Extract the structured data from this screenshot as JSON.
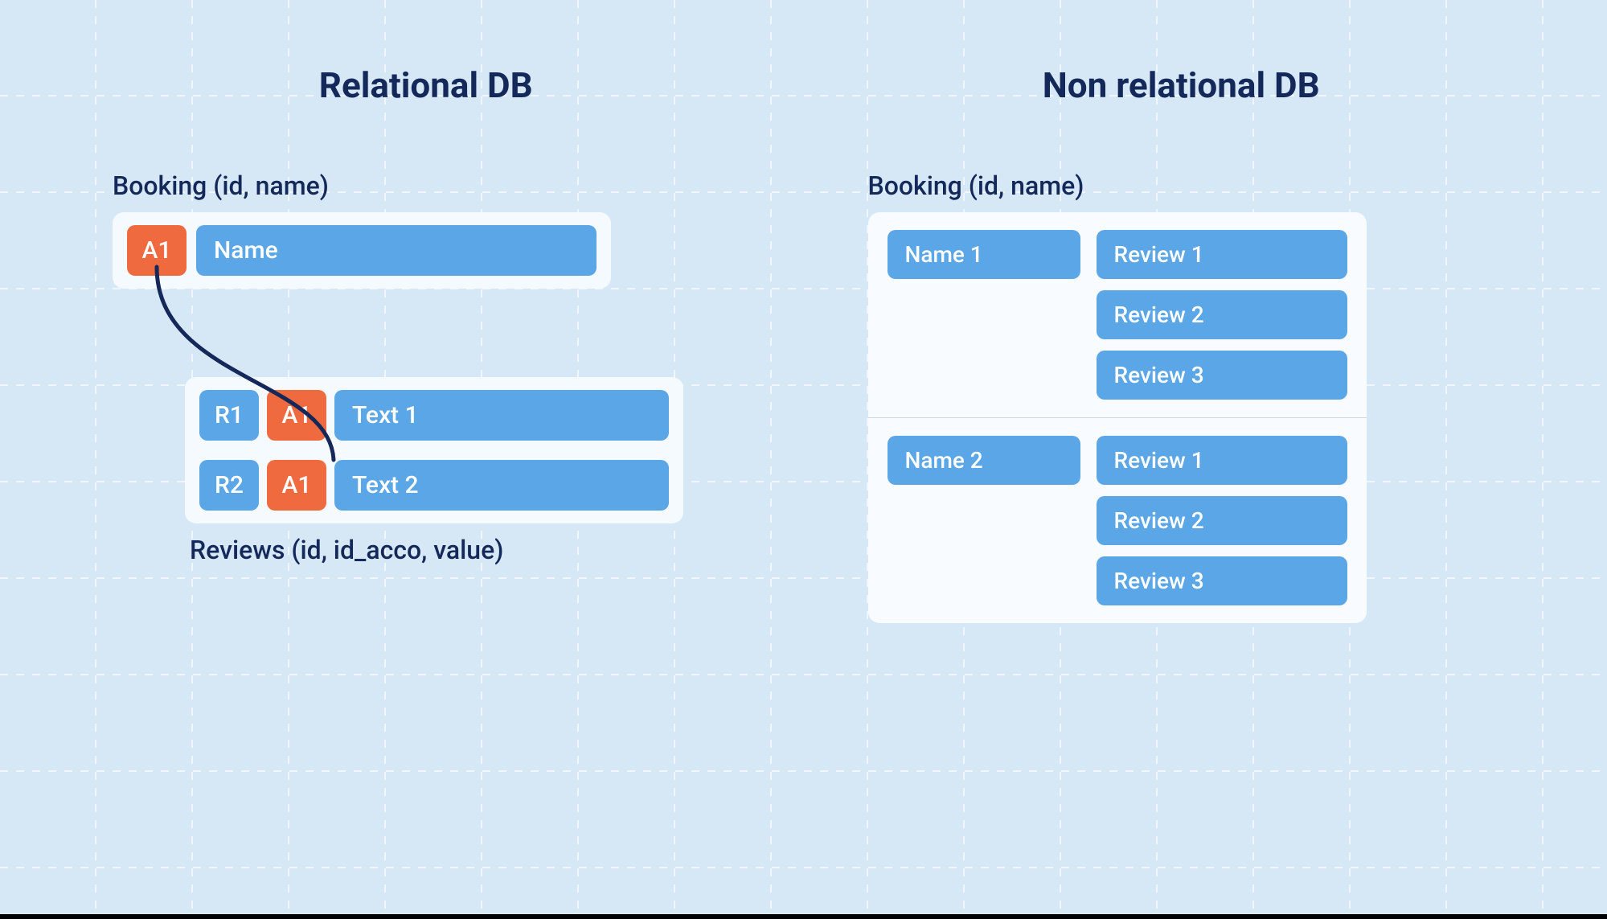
{
  "left": {
    "title": "Relational DB",
    "booking_label": "Booking (id, name)",
    "booking_row": {
      "id": "A1",
      "name": "Name"
    },
    "reviews_label": "Reviews (id, id_acco, value)",
    "reviews": [
      {
        "id": "R1",
        "fk": "A1",
        "text": "Text 1"
      },
      {
        "id": "R2",
        "fk": "A1",
        "text": "Text 2"
      }
    ]
  },
  "right": {
    "title": "Non relational DB",
    "booking_label": "Booking (id, name)",
    "docs": [
      {
        "name": "Name 1",
        "reviews": [
          "Review 1",
          "Review 2",
          "Review 3"
        ]
      },
      {
        "name": "Name 2",
        "reviews": [
          "Review 1",
          "Review 2",
          "Review 3"
        ]
      }
    ]
  },
  "colors": {
    "blue": "#5aa6e6",
    "orange": "#ef6a3e",
    "navy": "#14285a",
    "bg": "#d6e8f5"
  }
}
